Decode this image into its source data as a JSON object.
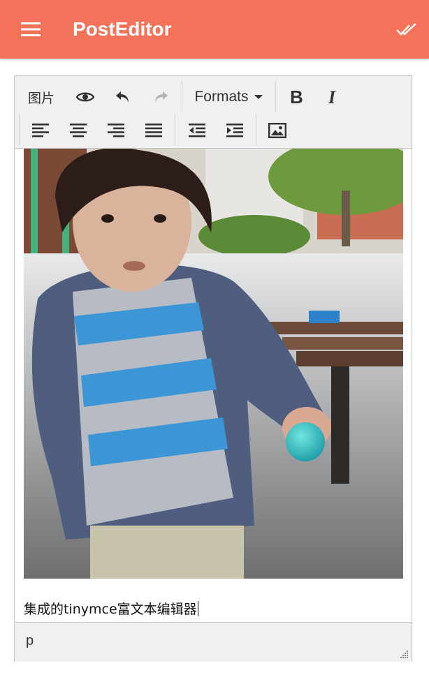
{
  "app_bar": {
    "title": "PostEditor",
    "menu_icon": "hamburger-menu-icon",
    "action_icon": "double-check-icon",
    "color": "#f2735a"
  },
  "toolbar": {
    "image_text_button": "图片",
    "preview_icon": "eye-icon",
    "undo_icon": "undo-icon",
    "redo_icon": "redo-icon",
    "formats_label": "Formats",
    "bold_icon": "bold-icon",
    "italic_icon": "italic-icon",
    "align_left_icon": "align-left-icon",
    "align_center_icon": "align-center-icon",
    "align_right_icon": "align-right-icon",
    "align_justify_icon": "align-justify-icon",
    "outdent_icon": "outdent-icon",
    "indent_icon": "indent-icon",
    "insert_image_icon": "insert-image-icon"
  },
  "content": {
    "image_alt": "photo",
    "text": "集成的tinymce富文本编辑器"
  },
  "status_bar": {
    "path": "p"
  }
}
